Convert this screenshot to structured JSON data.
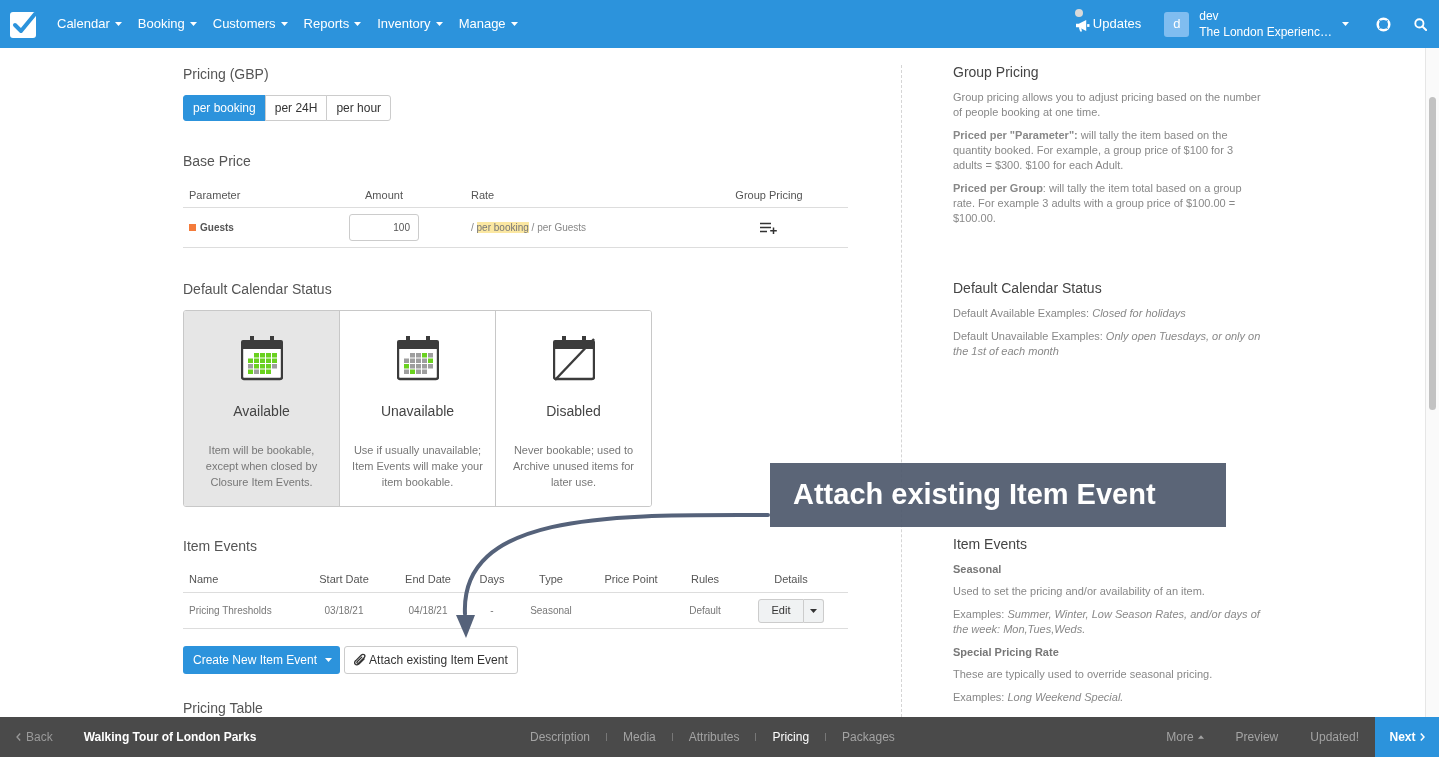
{
  "nav": {
    "menus": [
      {
        "label": "Calendar"
      },
      {
        "label": "Booking"
      },
      {
        "label": "Customers"
      },
      {
        "label": "Reports"
      },
      {
        "label": "Inventory"
      },
      {
        "label": "Manage"
      }
    ],
    "updates": "Updates",
    "user": {
      "initial": "d",
      "name": "dev",
      "organization": "The London Experienc…"
    }
  },
  "pricing": {
    "title": "Pricing (GBP)",
    "modes": [
      {
        "label": "per booking",
        "selected": true
      },
      {
        "label": "per 24H",
        "selected": false
      },
      {
        "label": "per hour",
        "selected": false
      }
    ]
  },
  "base_price": {
    "title": "Base Price",
    "columns": [
      "Parameter",
      "Amount",
      "Rate",
      "Group Pricing"
    ],
    "rows": [
      {
        "parameter": "Guests",
        "color": "#f47b3b",
        "amount": "100",
        "rate": [
          {
            "text": "/",
            "highlighted": false
          },
          {
            "text": "per booking",
            "highlighted": true
          },
          {
            "text": "/ per Guests",
            "highlighted": false
          }
        ]
      }
    ]
  },
  "calendar_status": {
    "title": "Default Calendar Status",
    "options": [
      {
        "kind": "available",
        "label": "Available",
        "description": "Item will be bookable, except when closed by Closure Item Events.",
        "selected": true
      },
      {
        "kind": "unavailable",
        "label": "Unavailable",
        "description": "Use if usually unavailable; Item Events will make your item bookable.",
        "selected": false
      },
      {
        "kind": "disabled",
        "label": "Disabled",
        "description": "Never bookable; used to Archive unused items for later use.",
        "selected": false
      }
    ]
  },
  "item_events": {
    "title": "Item Events",
    "columns": [
      "Name",
      "Start Date",
      "End Date",
      "Days",
      "Type",
      "Price Point",
      "Rules",
      "Details"
    ],
    "rows": [
      {
        "name": "Pricing Thresholds",
        "start_date": "03/18/21",
        "end_date": "04/18/21",
        "days": "-",
        "type": "Seasonal",
        "rules": "Default",
        "action": "Edit"
      }
    ],
    "actions": [
      {
        "kind": "primary",
        "label": "Create New Item Event"
      },
      {
        "kind": "attach",
        "label": "Attach existing Item Event"
      }
    ]
  },
  "pricing_table": {
    "title": "Pricing Table"
  },
  "help": [
    {
      "title": "Group Pricing",
      "blocks": [
        {
          "kind": "paragraph",
          "text": "Group pricing allows you to adjust pricing based on the number of people booking at one time."
        },
        {
          "kind": "paragraph",
          "text": "**Priced per \"Parameter\":** will tally the item based on the quantity booked. For example, a group price of $100 for 3 adults = $300. $100 for each Adult."
        },
        {
          "kind": "paragraph",
          "text": "**Priced per Group**: will tally the item total based on a group rate. For example 3 adults with a group price of $100.00 = $100.00."
        }
      ]
    },
    {
      "title": "Default Calendar Status",
      "blocks": [
        {
          "kind": "paragraph",
          "text": "Default Available Examples: *Closed for holidays*"
        },
        {
          "kind": "paragraph",
          "text": "Default Unavailable Examples: *Only open Tuesdays, or only on the 1st of each month*"
        }
      ]
    },
    {
      "title": "Item Events",
      "blocks": [
        {
          "kind": "subheading",
          "text": "Seasonal"
        },
        {
          "kind": "paragraph",
          "text": "Used to set the pricing and/or availability of an item."
        },
        {
          "kind": "paragraph",
          "text": "Examples: *Summer, Winter, Low Season Rates, and/or days of the week: Mon,Tues,Weds.*"
        },
        {
          "kind": "subheading",
          "text": "Special Pricing Rate"
        },
        {
          "kind": "paragraph",
          "text": "These are typically used to override seasonal pricing."
        },
        {
          "kind": "paragraph",
          "text": "Examples: *Long Weekend Special.*"
        }
      ]
    }
  ],
  "callout": {
    "text": "Attach existing Item Event"
  },
  "footer": {
    "back": "Back",
    "title": "Walking Tour of London Parks",
    "tabs": [
      {
        "label": "Description",
        "selected": false
      },
      {
        "label": "Media",
        "selected": false
      },
      {
        "label": "Attributes",
        "selected": false
      },
      {
        "label": "Pricing",
        "selected": true
      },
      {
        "label": "Packages",
        "selected": false
      }
    ],
    "more": "More",
    "preview": "Preview",
    "status": "Updated!",
    "next": "Next"
  }
}
